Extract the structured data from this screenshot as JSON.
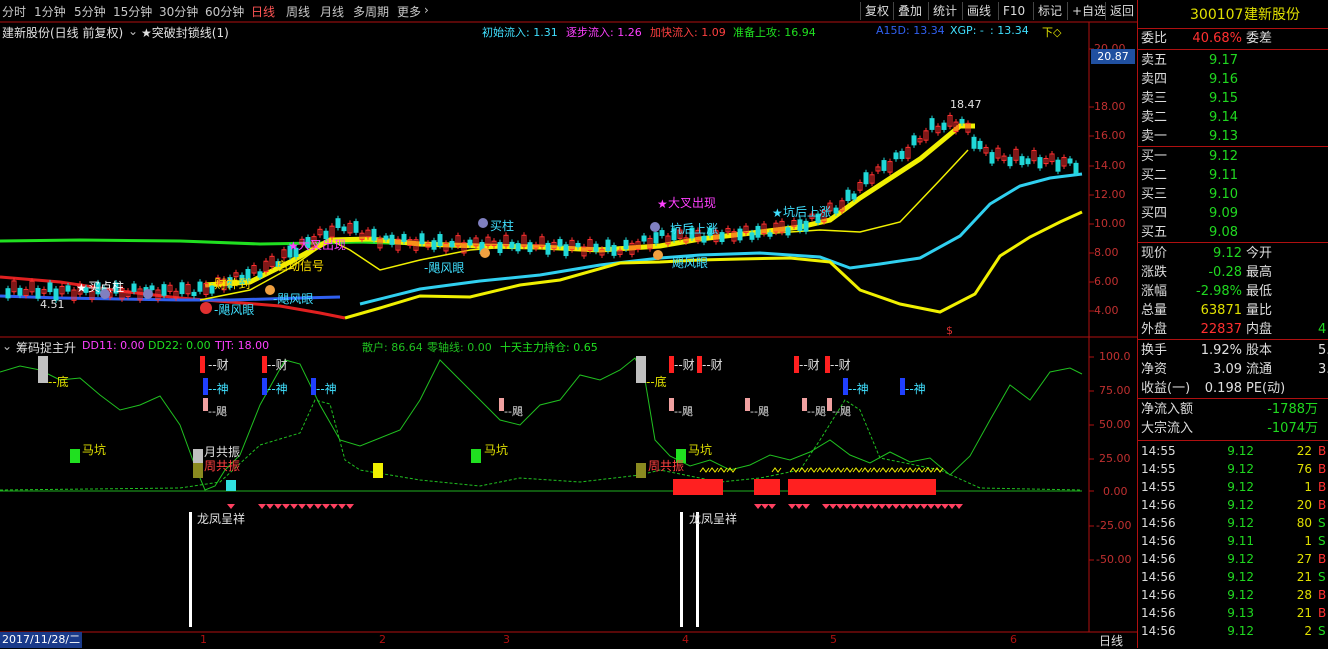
{
  "periods": [
    "分时",
    "1分钟",
    "5分钟",
    "15分钟",
    "30分钟",
    "60分钟",
    "日线",
    "周线",
    "月线",
    "多周期",
    "更多"
  ],
  "active_period": "日线",
  "toolbar": [
    "复权",
    "叠加",
    "统计",
    "画线",
    "F10",
    "标记",
    "+自选",
    "返回"
  ],
  "chart_title": "建新股份(日线 前复权)",
  "study_name": "★突破封锁线(1)",
  "indicators": {
    "a": "初始流入: 1.31",
    "b": "逐步流入: 1.26",
    "c": "加快流入: 1.09",
    "d": "准备上攻: 16.94",
    "e": "A15D: 13.34",
    "f": "XGP: -",
    "g": ": 13.34",
    "h": "下◇"
  },
  "price_axis": [
    "20.00",
    "18.00",
    "16.00",
    "14.00",
    "12.00",
    "10.00",
    "8.00",
    "6.00",
    "4.00"
  ],
  "price_highlight": "20.87",
  "annotations_main": {
    "high": "18.47",
    "low": "4.51",
    "buy_point": "买点柱",
    "big_cross": "大叉出现",
    "big_cross2": "大叉出现",
    "pit_up": "坑后上涨",
    "pit_up2": "坑后上涨",
    "buy_col": "买柱",
    "typhoon_eye": "-飓风眼",
    "typhoon_eye2": "-飓风眼",
    "typhoon_eye3": "-飓风眼",
    "typhoon_eye4": "飓风眼",
    "wealth_god": "-财神到",
    "start_sign": "启动信号"
  },
  "sub_title": "筹码捉主升",
  "sub_indicators": {
    "dd11": "DD11: 0.00",
    "dd22": "DD22: 0.00",
    "tjt": "TJT: 18.00",
    "sanhu": "散户: 86.64",
    "zero": "零轴线: 0.00",
    "ten": "十天主力持仓: 0.65"
  },
  "sub_axis": [
    "100.0",
    "75.00",
    "50.00",
    "25.00",
    "0.00",
    "-25.00",
    "-50.00"
  ],
  "sub_labels": {
    "di": "--底",
    "cai": "--财",
    "shen": "--神",
    "ju": "--飓",
    "makeng": "马坑",
    "yue": "月共振",
    "zhou": "周共振",
    "longfeng": "龙凤呈祥"
  },
  "date_axis": {
    "start": "2017/11/28/二",
    "months": [
      "1",
      "2",
      "3",
      "4",
      "5",
      "6"
    ],
    "right": "日线"
  },
  "stock": {
    "code": "300107",
    "name": "建新股份"
  },
  "weibi": {
    "label": "委比",
    "value": "40.68%",
    "label2": "委差"
  },
  "asks": [
    {
      "label": "卖五",
      "price": "9.17"
    },
    {
      "label": "卖四",
      "price": "9.16"
    },
    {
      "label": "卖三",
      "price": "9.15"
    },
    {
      "label": "卖二",
      "price": "9.14"
    },
    {
      "label": "卖一",
      "price": "9.13"
    }
  ],
  "bids": [
    {
      "label": "买一",
      "price": "9.12"
    },
    {
      "label": "买二",
      "price": "9.11"
    },
    {
      "label": "买三",
      "price": "9.10"
    },
    {
      "label": "买四",
      "price": "9.09"
    },
    {
      "label": "买五",
      "price": "9.08"
    }
  ],
  "quote": [
    {
      "l1": "现价",
      "v1": "9.12",
      "l2": "今开",
      "c": "#20d820"
    },
    {
      "l1": "涨跌",
      "v1": "-0.28",
      "l2": "最高",
      "c": "#20d820"
    },
    {
      "l1": "涨幅",
      "v1": "-2.98%",
      "l2": "最低",
      "c": "#20d820"
    },
    {
      "l1": "总量",
      "v1": "63871",
      "l2": "量比",
      "c": "#e0e000"
    },
    {
      "l1": "外盘",
      "v1": "22837",
      "l2": "内盘",
      "c": "#ff3030",
      "v2": "4"
    }
  ],
  "quote2": [
    {
      "l1": "换手",
      "v1": "1.92%",
      "l2": "股本",
      "v2": "5."
    },
    {
      "l1": "净资",
      "v1": "3.09",
      "l2": "流通",
      "v2": "3."
    },
    {
      "l1": "收益(一)",
      "v1": "0.198",
      "l2": "PE(动)",
      "v2": ""
    }
  ],
  "flows": [
    {
      "label": "净流入额",
      "value": "-1788万"
    },
    {
      "label": "大宗流入",
      "value": "-1074万"
    }
  ],
  "trades": [
    {
      "t": "14:55",
      "p": "9.12",
      "v": "22",
      "f": "B"
    },
    {
      "t": "14:55",
      "p": "9.12",
      "v": "76",
      "f": "B"
    },
    {
      "t": "14:55",
      "p": "9.12",
      "v": "1",
      "f": "B"
    },
    {
      "t": "14:56",
      "p": "9.12",
      "v": "20",
      "f": "B"
    },
    {
      "t": "14:56",
      "p": "9.12",
      "v": "80",
      "f": "S"
    },
    {
      "t": "14:56",
      "p": "9.11",
      "v": "1",
      "f": "S"
    },
    {
      "t": "14:56",
      "p": "9.12",
      "v": "27",
      "f": "B"
    },
    {
      "t": "14:56",
      "p": "9.12",
      "v": "21",
      "f": "S"
    },
    {
      "t": "14:56",
      "p": "9.12",
      "v": "28",
      "f": "B"
    },
    {
      "t": "14:56",
      "p": "9.13",
      "v": "21",
      "f": "B"
    },
    {
      "t": "14:56",
      "p": "9.12",
      "v": "2",
      "f": "S"
    }
  ],
  "colors": {
    "up": "#ff3030",
    "down": "#20d820",
    "axis": "#b01010",
    "ma_yellow": "#f0f000",
    "ma_cyan": "#30d0f0"
  }
}
